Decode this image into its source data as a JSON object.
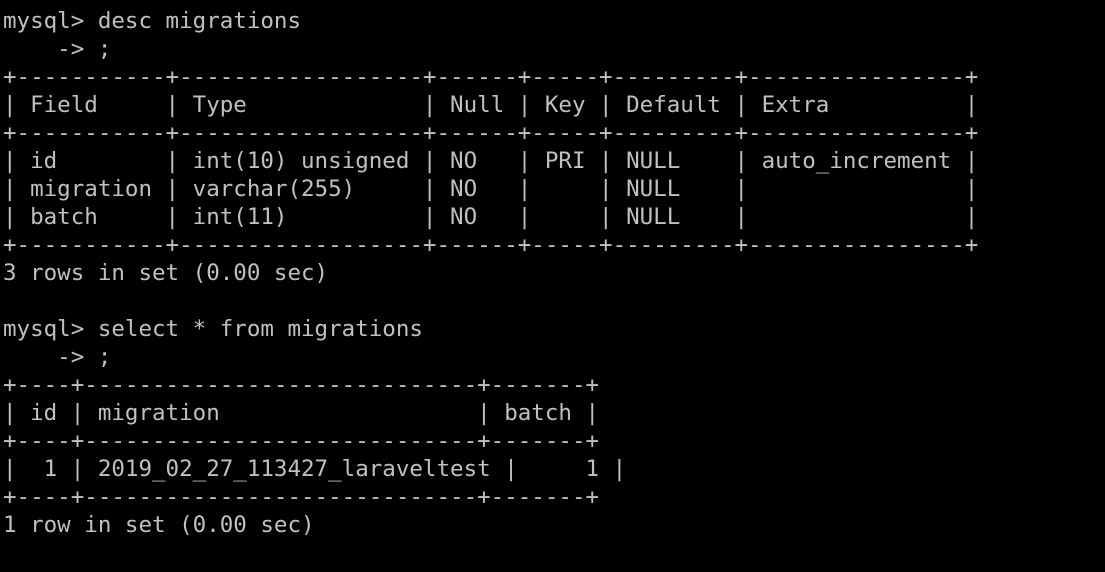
{
  "terminal": {
    "colors": {
      "background": "#000000",
      "foreground": "#c0c0c0"
    },
    "lines": [
      {
        "kind": "text",
        "name": "prompt-desc",
        "text": "mysql> desc migrations"
      },
      {
        "kind": "text",
        "name": "prompt-desc-continuation",
        "text": "    -> ;"
      },
      {
        "kind": "border",
        "name": "desc-table-top-border",
        "text": "+-----------+------------------+------+-----+---------+----------------+"
      },
      {
        "kind": "row",
        "name": "desc-table-header",
        "text": "| Field     | Type             | Null | Key | Default | Extra          |"
      },
      {
        "kind": "border",
        "name": "desc-table-header-border",
        "text": "+-----------+------------------+------+-----+---------+----------------+"
      },
      {
        "kind": "row",
        "name": "desc-table-row-id",
        "text": "| id        | int(10) unsigned | NO   | PRI | NULL    | auto_increment |"
      },
      {
        "kind": "row",
        "name": "desc-table-row-migration",
        "text": "| migration | varchar(255)     | NO   |     | NULL    |                |"
      },
      {
        "kind": "row",
        "name": "desc-table-row-batch",
        "text": "| batch     | int(11)          | NO   |     | NULL    |                |"
      },
      {
        "kind": "border",
        "name": "desc-table-bottom-border",
        "text": "+-----------+------------------+------+-----+---------+----------------+"
      },
      {
        "kind": "text",
        "name": "desc-result-summary",
        "text": "3 rows in set (0.00 sec)"
      },
      {
        "kind": "blank",
        "name": "blank-line",
        "text": ""
      },
      {
        "kind": "text",
        "name": "prompt-select",
        "text": "mysql> select * from migrations"
      },
      {
        "kind": "text",
        "name": "prompt-select-continuation",
        "text": "    -> ;"
      },
      {
        "kind": "border",
        "name": "select-table-top-border",
        "text": "+----+-----------------------------+-------+"
      },
      {
        "kind": "row",
        "name": "select-table-header",
        "text": "| id | migration                   | batch |"
      },
      {
        "kind": "border",
        "name": "select-table-header-border",
        "text": "+----+-----------------------------+-------+"
      },
      {
        "kind": "row",
        "name": "select-table-row-1",
        "text": "|  1 | 2019_02_27_113427_laraveltest |     1 |"
      },
      {
        "kind": "border",
        "name": "select-table-bottom-border",
        "text": "+----+-----------------------------+-------+"
      },
      {
        "kind": "text",
        "name": "select-result-summary",
        "text": "1 row in set (0.00 sec)"
      }
    ]
  }
}
